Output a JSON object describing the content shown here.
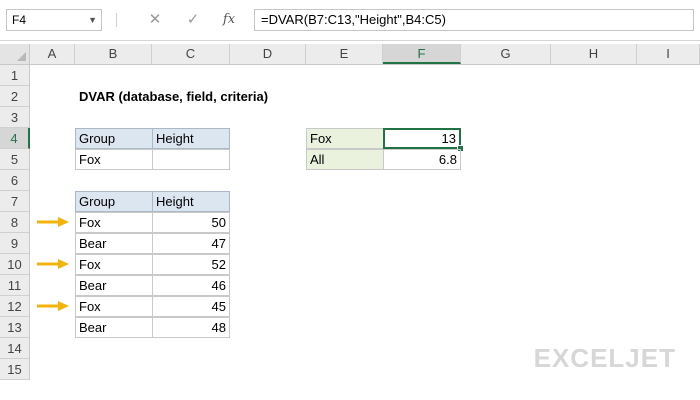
{
  "formula_bar": {
    "name_box": "F4",
    "cancel_icon": "✕",
    "enter_icon": "✓",
    "fx_label": "fx",
    "formula": "=DVAR(B7:C13,\"Height\",B4:C5)"
  },
  "columns": [
    "A",
    "B",
    "C",
    "D",
    "E",
    "F",
    "G",
    "H",
    "I"
  ],
  "rows": [
    "1",
    "2",
    "3",
    "4",
    "5",
    "6",
    "7",
    "8",
    "9",
    "10",
    "11",
    "12",
    "13",
    "14",
    "15"
  ],
  "active_cell": {
    "col": "F",
    "row": "4"
  },
  "title": "DVAR (database, field, criteria)",
  "criteria": {
    "headers": [
      "Group",
      "Height"
    ],
    "row": [
      "Fox",
      ""
    ]
  },
  "database": {
    "headers": [
      "Group",
      "Height"
    ],
    "rows": [
      [
        "Fox",
        "50"
      ],
      [
        "Bear",
        "47"
      ],
      [
        "Fox",
        "52"
      ],
      [
        "Bear",
        "46"
      ],
      [
        "Fox",
        "45"
      ],
      [
        "Bear",
        "48"
      ]
    ]
  },
  "results": [
    {
      "label": "Fox",
      "value": "13"
    },
    {
      "label": "All",
      "value": "6.8"
    }
  ],
  "arrow_color": "#f2b30d",
  "logo": "EXCELJET"
}
